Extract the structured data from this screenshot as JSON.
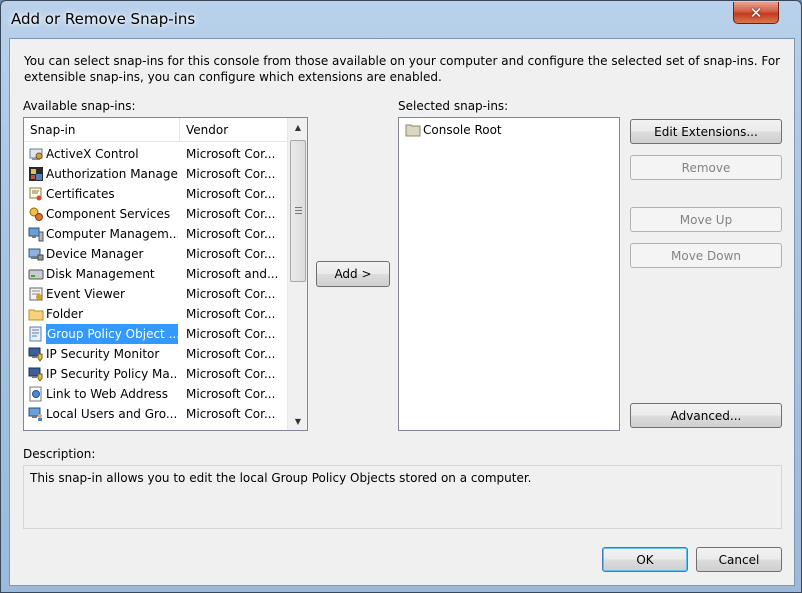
{
  "window": {
    "title": "Add or Remove Snap-ins",
    "close_glyph": "✕"
  },
  "intro": "You can select snap-ins for this console from those available on your computer and configure the selected set of snap-ins. For extensible snap-ins, you can configure which extensions are enabled.",
  "available": {
    "label": "Available snap-ins:",
    "columns": {
      "snapin": "Snap-in",
      "vendor": "Vendor"
    },
    "items": [
      {
        "name": "ActiveX Control",
        "vendor": "Microsoft Cor...",
        "icon": "activex-icon"
      },
      {
        "name": "Authorization Manager",
        "vendor": "Microsoft Cor...",
        "icon": "authorization-icon"
      },
      {
        "name": "Certificates",
        "vendor": "Microsoft Cor...",
        "icon": "certificate-icon"
      },
      {
        "name": "Component Services",
        "vendor": "Microsoft Cor...",
        "icon": "component-services-icon"
      },
      {
        "name": "Computer Managem...",
        "vendor": "Microsoft Cor...",
        "icon": "computer-management-icon"
      },
      {
        "name": "Device Manager",
        "vendor": "Microsoft Cor...",
        "icon": "device-manager-icon"
      },
      {
        "name": "Disk Management",
        "vendor": "Microsoft and...",
        "icon": "disk-icon"
      },
      {
        "name": "Event Viewer",
        "vendor": "Microsoft Cor...",
        "icon": "event-viewer-icon"
      },
      {
        "name": "Folder",
        "vendor": "Microsoft Cor...",
        "icon": "folder-icon"
      },
      {
        "name": "Group Policy Object ...",
        "vendor": "Microsoft Cor...",
        "icon": "group-policy-icon"
      },
      {
        "name": "IP Security Monitor",
        "vendor": "Microsoft Cor...",
        "icon": "ip-security-icon"
      },
      {
        "name": "IP Security Policy Ma...",
        "vendor": "Microsoft Cor...",
        "icon": "ip-security-policy-icon"
      },
      {
        "name": "Link to Web Address",
        "vendor": "Microsoft Cor...",
        "icon": "web-link-icon"
      },
      {
        "name": "Local Users and Gro...",
        "vendor": "Microsoft Cor...",
        "icon": "local-users-icon"
      }
    ]
  },
  "add_button": "Add >",
  "selected": {
    "label": "Selected snap-ins:",
    "root": "Console Root"
  },
  "buttons": {
    "edit_extensions": "Edit Extensions...",
    "remove": "Remove",
    "move_up": "Move Up",
    "move_down": "Move Down",
    "advanced": "Advanced...",
    "ok": "OK",
    "cancel": "Cancel"
  },
  "description": {
    "label": "Description:",
    "text": "This snap-in allows you to edit the local Group Policy Objects stored on a computer."
  },
  "colors": {
    "selection": "#3399ff",
    "disabled_text": "#838383"
  }
}
